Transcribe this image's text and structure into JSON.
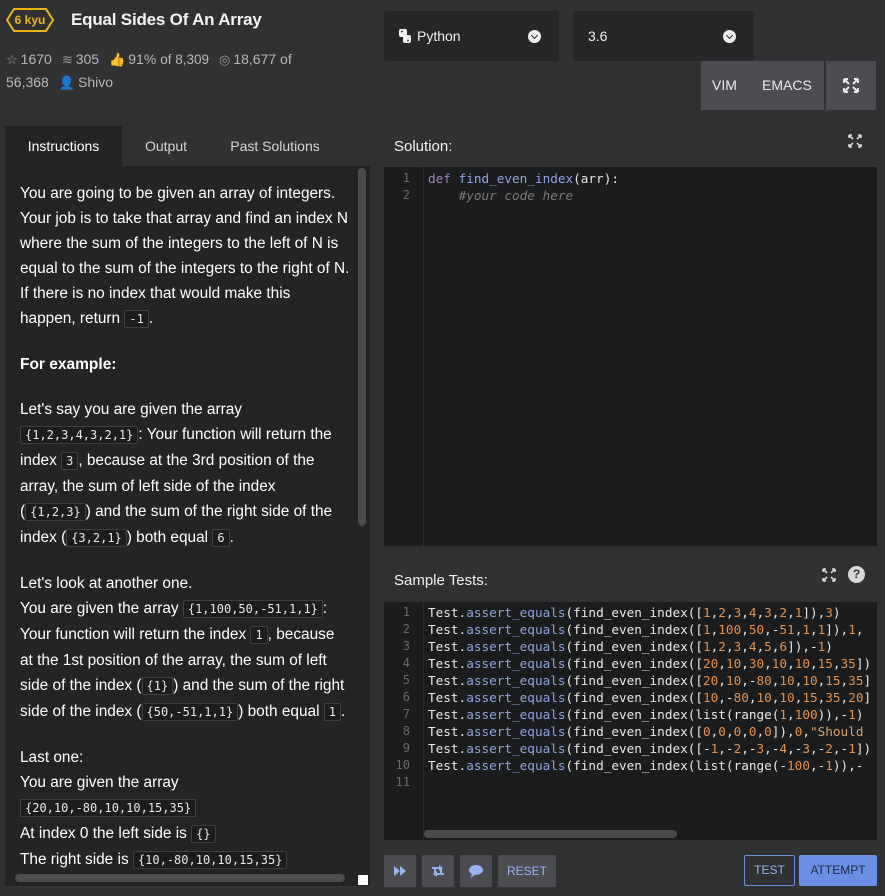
{
  "kata": {
    "rank": "6 kyu",
    "title": "Equal Sides Of An Array"
  },
  "stats": {
    "stars": "1670",
    "collections": "305",
    "satisfaction": "91%",
    "satisfaction_of": "of 8,309",
    "completed": "18,677",
    "completed_of": "of",
    "total": "56,368",
    "author": "Shivo"
  },
  "language": {
    "selected": "Python"
  },
  "version": {
    "selected": "3.6"
  },
  "modes": {
    "vim": "VIM",
    "emacs": "EMACS"
  },
  "tabs": [
    {
      "label": "Instructions"
    },
    {
      "label": "Output"
    },
    {
      "label": "Past Solutions"
    }
  ],
  "instructions": {
    "p1": "You are going to be given an array of integers. Your job is to take that array and find an index N where the sum of the integers to the left of N is equal to the sum of the integers to the right of N. If there is no index that would make this happen, return ",
    "p1_code": "-1",
    "p1_end": ".",
    "h1": "For example:",
    "p2a": "Let's say you are given the array ",
    "p2_code1": "{1,2,3,4,3,2,1}",
    "p2b": ": Your function will return the index ",
    "p2_code2": "3",
    "p2c": ", because at the 3rd position of the array, the sum of left side of the index (",
    "p2_code3": "{1,2,3}",
    "p2d": ") and the sum of the right side of the index (",
    "p2_code4": "{3,2,1}",
    "p2e": ") both equal ",
    "p2_code5": "6",
    "p2f": ".",
    "p3a": "Let's look at another one.",
    "p3b": "You are given the array ",
    "p3_code1": "{1,100,50,-51,1,1}",
    "p3c": ": Your function will return the index ",
    "p3_code2": "1",
    "p3d": ", because at the 1st position of the array, the sum of left side of the index (",
    "p3_code3": "{1}",
    "p3e": ") and the sum of the right side of the index (",
    "p3_code4": "{50,-51,1,1}",
    "p3f": ") both equal ",
    "p3_code5": "1",
    "p3g": ".",
    "p4a": "Last one:",
    "p4b": "You are given the array ",
    "p4_code1": "{20,10,-80,10,10,15,35}",
    "p4c": "At index 0 the left side is ",
    "p4_code2": "{}",
    "p4d": "The right side is ",
    "p4_code3": "{10,-80,10,10,15,35}"
  },
  "solution": {
    "title": "Solution:",
    "line_numbers": [
      "1",
      "2"
    ],
    "lines": [
      [
        [
          "kw",
          "def "
        ],
        [
          "fn",
          "find_even_index"
        ],
        [
          "",
          "(arr):"
        ]
      ],
      [
        [
          "",
          "    "
        ],
        [
          "cm",
          "#your code here"
        ]
      ]
    ]
  },
  "sample_tests": {
    "title": "Sample Tests:",
    "line_numbers": [
      "1",
      "2",
      "3",
      "4",
      "5",
      "6",
      "7",
      "8",
      "9",
      "10",
      "11"
    ],
    "lines": [
      [
        [
          "",
          "Test."
        ],
        [
          "meth",
          "assert_equals"
        ],
        [
          "",
          "(find_even_index(["
        ],
        [
          "num",
          "1"
        ],
        [
          "",
          ","
        ],
        [
          "num",
          "2"
        ],
        [
          "",
          ","
        ],
        [
          "num",
          "3"
        ],
        [
          "",
          ","
        ],
        [
          "num",
          "4"
        ],
        [
          "",
          ","
        ],
        [
          "num",
          "3"
        ],
        [
          "",
          ","
        ],
        [
          "num",
          "2"
        ],
        [
          "",
          ","
        ],
        [
          "num",
          "1"
        ],
        [
          "",
          "]),"
        ],
        [
          "num",
          "3"
        ],
        [
          "",
          ")"
        ]
      ],
      [
        [
          "",
          "Test."
        ],
        [
          "meth",
          "assert_equals"
        ],
        [
          "",
          "(find_even_index(["
        ],
        [
          "num",
          "1"
        ],
        [
          "",
          ","
        ],
        [
          "num",
          "100"
        ],
        [
          "",
          ","
        ],
        [
          "num",
          "50"
        ],
        [
          "",
          ",-"
        ],
        [
          "num",
          "51"
        ],
        [
          "",
          ","
        ],
        [
          "num",
          "1"
        ],
        [
          "",
          ","
        ],
        [
          "num",
          "1"
        ],
        [
          "",
          "]),"
        ],
        [
          "num",
          "1"
        ],
        [
          "",
          ","
        ]
      ],
      [
        [
          "",
          "Test."
        ],
        [
          "meth",
          "assert_equals"
        ],
        [
          "",
          "(find_even_index(["
        ],
        [
          "num",
          "1"
        ],
        [
          "",
          ","
        ],
        [
          "num",
          "2"
        ],
        [
          "",
          ","
        ],
        [
          "num",
          "3"
        ],
        [
          "",
          ","
        ],
        [
          "num",
          "4"
        ],
        [
          "",
          ","
        ],
        [
          "num",
          "5"
        ],
        [
          "",
          ","
        ],
        [
          "num",
          "6"
        ],
        [
          "",
          "]),-"
        ],
        [
          "num",
          "1"
        ],
        [
          "",
          ")"
        ]
      ],
      [
        [
          "",
          "Test."
        ],
        [
          "meth",
          "assert_equals"
        ],
        [
          "",
          "(find_even_index(["
        ],
        [
          "num",
          "20"
        ],
        [
          "",
          ","
        ],
        [
          "num",
          "10"
        ],
        [
          "",
          ","
        ],
        [
          "num",
          "30"
        ],
        [
          "",
          ","
        ],
        [
          "num",
          "10"
        ],
        [
          "",
          ","
        ],
        [
          "num",
          "10"
        ],
        [
          "",
          ","
        ],
        [
          "num",
          "15"
        ],
        [
          "",
          ","
        ],
        [
          "num",
          "35"
        ],
        [
          "",
          "])"
        ]
      ],
      [
        [
          "",
          "Test."
        ],
        [
          "meth",
          "assert_equals"
        ],
        [
          "",
          "(find_even_index(["
        ],
        [
          "num",
          "20"
        ],
        [
          "",
          ","
        ],
        [
          "num",
          "10"
        ],
        [
          "",
          ",-"
        ],
        [
          "num",
          "80"
        ],
        [
          "",
          ","
        ],
        [
          "num",
          "10"
        ],
        [
          "",
          ","
        ],
        [
          "num",
          "10"
        ],
        [
          "",
          ","
        ],
        [
          "num",
          "15"
        ],
        [
          "",
          ","
        ],
        [
          "num",
          "35"
        ],
        [
          "",
          "]"
        ]
      ],
      [
        [
          "",
          "Test."
        ],
        [
          "meth",
          "assert_equals"
        ],
        [
          "",
          "(find_even_index(["
        ],
        [
          "num",
          "10"
        ],
        [
          "",
          ",-"
        ],
        [
          "num",
          "80"
        ],
        [
          "",
          ","
        ],
        [
          "num",
          "10"
        ],
        [
          "",
          ","
        ],
        [
          "num",
          "10"
        ],
        [
          "",
          ","
        ],
        [
          "num",
          "15"
        ],
        [
          "",
          ","
        ],
        [
          "num",
          "35"
        ],
        [
          "",
          ","
        ],
        [
          "num",
          "20"
        ],
        [
          "",
          "]"
        ]
      ],
      [
        [
          "",
          "Test."
        ],
        [
          "meth",
          "assert_equals"
        ],
        [
          "",
          "(find_even_index(list(range("
        ],
        [
          "num",
          "1"
        ],
        [
          "",
          ","
        ],
        [
          "num",
          "100"
        ],
        [
          "",
          ")),-"
        ],
        [
          "num",
          "1"
        ],
        [
          "",
          ")"
        ]
      ],
      [
        [
          "",
          "Test."
        ],
        [
          "meth",
          "assert_equals"
        ],
        [
          "",
          "(find_even_index(["
        ],
        [
          "num",
          "0"
        ],
        [
          "",
          ","
        ],
        [
          "num",
          "0"
        ],
        [
          "",
          ","
        ],
        [
          "num",
          "0"
        ],
        [
          "",
          ","
        ],
        [
          "num",
          "0"
        ],
        [
          "",
          ","
        ],
        [
          "num",
          "0"
        ],
        [
          "",
          "]),"
        ],
        [
          "num",
          "0"
        ],
        [
          "",
          ","
        ],
        [
          "str",
          "\"Should "
        ]
      ],
      [
        [
          "",
          "Test."
        ],
        [
          "meth",
          "assert_equals"
        ],
        [
          "",
          "(find_even_index([-"
        ],
        [
          "num",
          "1"
        ],
        [
          "",
          ",-"
        ],
        [
          "num",
          "2"
        ],
        [
          "",
          ",-"
        ],
        [
          "num",
          "3"
        ],
        [
          "",
          ",-"
        ],
        [
          "num",
          "4"
        ],
        [
          "",
          ",-"
        ],
        [
          "num",
          "3"
        ],
        [
          "",
          ",-"
        ],
        [
          "num",
          "2"
        ],
        [
          "",
          ",-"
        ],
        [
          "num",
          "1"
        ],
        [
          "",
          "])"
        ]
      ],
      [
        [
          "",
          "Test."
        ],
        [
          "meth",
          "assert_equals"
        ],
        [
          "",
          "(find_even_index(list(range(-"
        ],
        [
          "num",
          "100"
        ],
        [
          "",
          ",-"
        ],
        [
          "num",
          "1"
        ],
        [
          "",
          ")),-"
        ]
      ],
      []
    ]
  },
  "buttons": {
    "reset": "RESET",
    "test": "TEST",
    "attempt": "ATTEMPT"
  },
  "colors": {
    "background": "#303133",
    "panel": "#232426",
    "editor": "#1b1c1e",
    "rank_yellow": "#ecb613",
    "accent_blue": "#6a90e6"
  }
}
